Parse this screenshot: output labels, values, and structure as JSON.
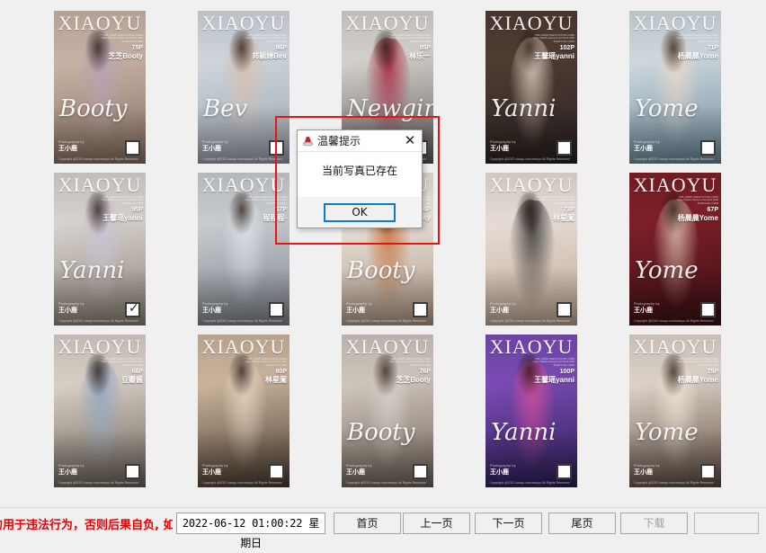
{
  "window": {
    "background_color": "#f0f0f0"
  },
  "gallery": {
    "masthead": "XIAOYU",
    "micro_line_1": "VOL.0000 XIAOYUYUU.COM",
    "micro_line_2": "http://www.xiaoyu.com/vol.000",
    "micro_line_3": "XIAOYUU.COM",
    "photographer_label": "Photography by",
    "photographer": "王小鹿",
    "copyright": "Copyright @2022 xiaoyu.com/xiaoyu All Rights Reserved",
    "checkbox_tick": "✓",
    "cards": [
      {
        "masthead": "XIAOYU",
        "pages": "75P",
        "model": "芝芝Booty",
        "script_overlay": "Booty",
        "checked": false,
        "bg_top": "#c8b3a6",
        "bg_bottom": "#8b7263",
        "accent": "#b9a2b8",
        "script_color": "rgba(255,255,255,0.92)"
      },
      {
        "masthead": "XIAOYU",
        "pages": "86P",
        "model": "邦颖婵Bev",
        "script_overlay": "Bev",
        "checked": false,
        "bg_top": "#cfd6dc",
        "bg_bottom": "#9aa4ad",
        "accent": "#d9bfae",
        "script_color": "rgba(255,255,255,0.92)"
      },
      {
        "masthead": "XIAOYU",
        "pages": "85P",
        "model": "林乐一",
        "script_overlay": "Newgirl",
        "checked": false,
        "bg_top": "#d5d2cd",
        "bg_bottom": "#5f5a58",
        "accent": "#a81f3c",
        "script_color": "rgba(255,255,255,0.9)"
      },
      {
        "masthead": "XIAOYU",
        "pages": "102P",
        "model": "王馨瑶yanni",
        "script_overlay": "Yanni",
        "checked": false,
        "bg_top": "#4f3c33",
        "bg_bottom": "#2a2220",
        "accent": "#e6d6c6",
        "script_color": "rgba(255,255,255,0.9)"
      },
      {
        "masthead": "XIAOYU",
        "pages": "71P",
        "model": "杨晨晨Yome",
        "script_overlay": "Yome",
        "checked": false,
        "bg_top": "#cfd9de",
        "bg_bottom": "#6d8a9c",
        "accent": "#e9d8cb",
        "script_color": "rgba(255,255,255,0.9)"
      },
      {
        "masthead": "XIAOYU",
        "pages": "95P",
        "model": "王馨瑶yanni",
        "script_overlay": "Yanni",
        "checked": true,
        "bg_top": "#d7d3cf",
        "bg_bottom": "#8e8376",
        "accent": "#c9c2d6",
        "script_color": "rgba(255,255,255,0.9)"
      },
      {
        "masthead": "XIAOYU",
        "pages": "67P",
        "model": "程程程-",
        "script_overlay": "",
        "checked": false,
        "bg_top": "#c9ccd0",
        "bg_bottom": "#7f858c",
        "accent": "#dbe3ea",
        "script_color": "rgba(255,255,255,0.9)"
      },
      {
        "masthead": "XIAOYU",
        "pages": "74P",
        "model": "芝芝Booty",
        "script_overlay": "Booty",
        "checked": false,
        "bg_top": "#e8e2dc",
        "bg_bottom": "#b39a86",
        "accent": "#c56a2e",
        "script_color": "rgba(255,255,255,0.92)"
      },
      {
        "masthead": "XIAOYU",
        "pages": "73P",
        "model": "林星阑",
        "script_overlay": "",
        "checked": false,
        "bg_top": "#e7ddd6",
        "bg_bottom": "#c0a996",
        "accent": "#2b2b2b",
        "script_color": "rgba(255,255,255,0.9)"
      },
      {
        "masthead": "XIAOYU",
        "pages": "67P",
        "model": "杨晨晨Yome",
        "script_overlay": "Yome",
        "checked": false,
        "bg_top": "#7e1f28",
        "bg_bottom": "#3a1014",
        "accent": "#e3c8b5",
        "script_color": "rgba(255,255,255,0.9)"
      },
      {
        "masthead": "XIAOYU",
        "pages": "66P",
        "model": "豆瓣酱",
        "script_overlay": "",
        "checked": false,
        "bg_top": "#d8cfc6",
        "bg_bottom": "#6c6258",
        "accent": "#8fa6c4",
        "script_color": "rgba(255,255,255,0.9)"
      },
      {
        "masthead": "XIAOYU",
        "pages": "80P",
        "model": "林星阑",
        "script_overlay": "",
        "checked": false,
        "bg_top": "#cbb49c",
        "bg_bottom": "#4a3b30",
        "accent": "#e8d9c6",
        "script_color": "rgba(255,255,255,0.9)"
      },
      {
        "masthead": "XIAOYU",
        "pages": "76P",
        "model": "芝芝Booty",
        "script_overlay": "Booty",
        "checked": false,
        "bg_top": "#cfc6bd",
        "bg_bottom": "#6f6257",
        "accent": "#d8d2cb",
        "script_color": "rgba(255,255,255,0.92)"
      },
      {
        "masthead": "XIAOYU",
        "pages": "100P",
        "model": "王馨瑶yanni",
        "script_overlay": "Yanni",
        "checked": false,
        "bg_top": "#7a4bb5",
        "bg_bottom": "#2c1e55",
        "accent": "#d94f9a",
        "script_color": "rgba(255,255,255,0.92)"
      },
      {
        "masthead": "XIAOYU",
        "pages": "75P",
        "model": "杨晨晨Yome",
        "script_overlay": "Yome",
        "checked": false,
        "bg_top": "#ddd3c9",
        "bg_bottom": "#5d4a3e",
        "accent": "#efe4d6",
        "script_color": "rgba(255,255,255,0.9)"
      }
    ]
  },
  "selection_rect": {
    "color": "#e81313"
  },
  "dialog": {
    "title": "温馨提示",
    "message": "当前写真已存在",
    "ok_label": "OK",
    "close_label": "✕",
    "accent_color": "#0a7cd4"
  },
  "toolbar": {
    "notice": "勿用于违法行为，否则后果自负, 如有",
    "notice_color": "#e60000",
    "datetime": "2022-06-12 01:00:22 星期日",
    "buttons": {
      "first": "首页",
      "prev": "上一页",
      "next": "下一页",
      "last": "尾页",
      "download": "下载"
    },
    "download_disabled": true
  }
}
